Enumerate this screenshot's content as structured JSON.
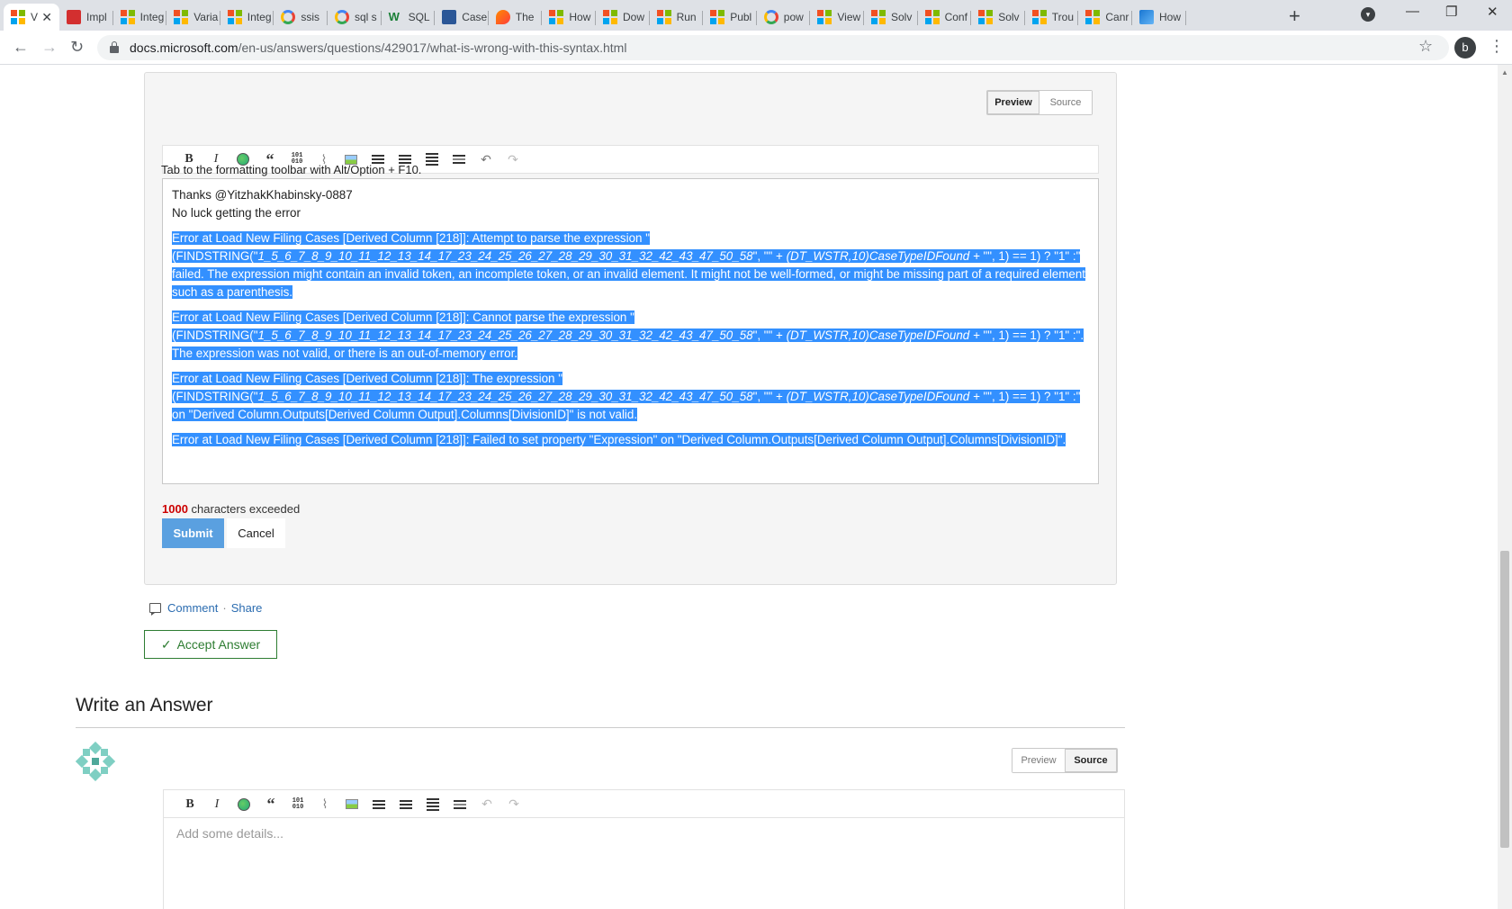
{
  "browser": {
    "tabs": [
      {
        "label": "V",
        "favicon": "ms",
        "active": true
      },
      {
        "label": "Impl",
        "favicon": "pdf"
      },
      {
        "label": "Integ",
        "favicon": "ms"
      },
      {
        "label": "Varia",
        "favicon": "ms"
      },
      {
        "label": "Integ",
        "favicon": "ms"
      },
      {
        "label": "ssis",
        "favicon": "g"
      },
      {
        "label": "sql s",
        "favicon": "g"
      },
      {
        "label": "SQL",
        "favicon": "w"
      },
      {
        "label": "Case",
        "favicon": "c"
      },
      {
        "label": "The",
        "favicon": "b"
      },
      {
        "label": "How",
        "favicon": "ms"
      },
      {
        "label": "Dow",
        "favicon": "ms"
      },
      {
        "label": "Run",
        "favicon": "ms"
      },
      {
        "label": "Publ",
        "favicon": "ms"
      },
      {
        "label": "pow",
        "favicon": "g"
      },
      {
        "label": "View",
        "favicon": "ms"
      },
      {
        "label": "Solv",
        "favicon": "ms"
      },
      {
        "label": "Conf",
        "favicon": "ms"
      },
      {
        "label": "Solv",
        "favicon": "ms"
      },
      {
        "label": "Trou",
        "favicon": "ms"
      },
      {
        "label": "Canr",
        "favicon": "ms"
      },
      {
        "label": "How",
        "favicon": "pbi"
      }
    ],
    "url_host": "docs.microsoft.com",
    "url_path": "/en-us/answers/questions/429017/what-is-wrong-with-this-syntax.html",
    "profile_letter": "b"
  },
  "edit": {
    "preview_label": "Preview",
    "source_label": "Source",
    "toolbar_hint": "Tab to the formatting toolbar with Alt/Option + F10.",
    "line1": "Thanks @YitzhakKhabinsky-0887",
    "line2": "No luck getting the error",
    "err1_a": "Error at Load New Filing Cases [Derived Column [218]]: Attempt to parse the expression \"(FINDSTRING(\"",
    "err1_b": "1_5_6_7_8_9_10_11_12_13_14_17_23_24_25_26_27_28_29_30_31_32_42_43_47_50_58",
    "err1_c": "\", \"\" + ",
    "err1_d": "(DT_WSTR,10)CaseTypeIDFound + ",
    "err1_e": "\"\", 1) == 1) ? \"1\" :\" failed. The expression might contain an invalid token, an incomplete token, or an invalid element. It might not be well-formed, or might be missing part of a required element such as a parenthesis.",
    "err2_a": "Error at Load New Filing Cases [Derived Column [218]]: Cannot parse the expression \"(FINDSTRING(\"",
    "err2_b": "1_5_6_7_8_9_10_11_12_13_14_17_23_24_25_26_27_28_29_30_31_32_42_43_47_50_58",
    "err2_c": "\", \"\" + ",
    "err2_d": "(DT_WSTR,10)CaseTypeIDFound + ",
    "err2_e": "\"\", 1) == 1) ? \"1\" :\". The expression was not valid, or there is an out-of-memory error.",
    "err3_a": "Error at Load New Filing Cases [Derived Column [218]]: The expression \"(FINDSTRING(\"",
    "err3_b": "1_5_6_7_8_9_10_11_12_13_14_17_23_24_25_26_27_28_29_30_31_32_42_43_47_50_58",
    "err3_c": "\", \"\" + ",
    "err3_d": "(DT_WSTR,10)CaseTypeIDFound + ",
    "err3_e": "\"\", 1) == 1) ? \"1\" :\" on \"Derived Column.Outputs[Derived Column Output].Columns[DivisionID]\" is not valid.",
    "err4": "Error at Load New Filing Cases [Derived Column [218]]: Failed to set property \"Expression\" on \"Derived Column.Outputs[Derived Column Output].Columns[DivisionID]\".",
    "char_limit": "1000",
    "char_suffix": " characters exceeded",
    "submit_label": "Submit",
    "cancel_label": "Cancel"
  },
  "actions": {
    "comment_label": "Comment",
    "separator": "·",
    "share_label": "Share",
    "accept_label": "Accept Answer"
  },
  "answer": {
    "heading": "Write an Answer",
    "preview_label": "Preview",
    "source_label": "Source",
    "placeholder": "Add some details..."
  },
  "colors": {
    "selection": "#3390ff",
    "submit": "#5aa0e0",
    "accept": "#2e7d32",
    "link": "#2b6cb0",
    "char_limit": "#cc0000"
  }
}
